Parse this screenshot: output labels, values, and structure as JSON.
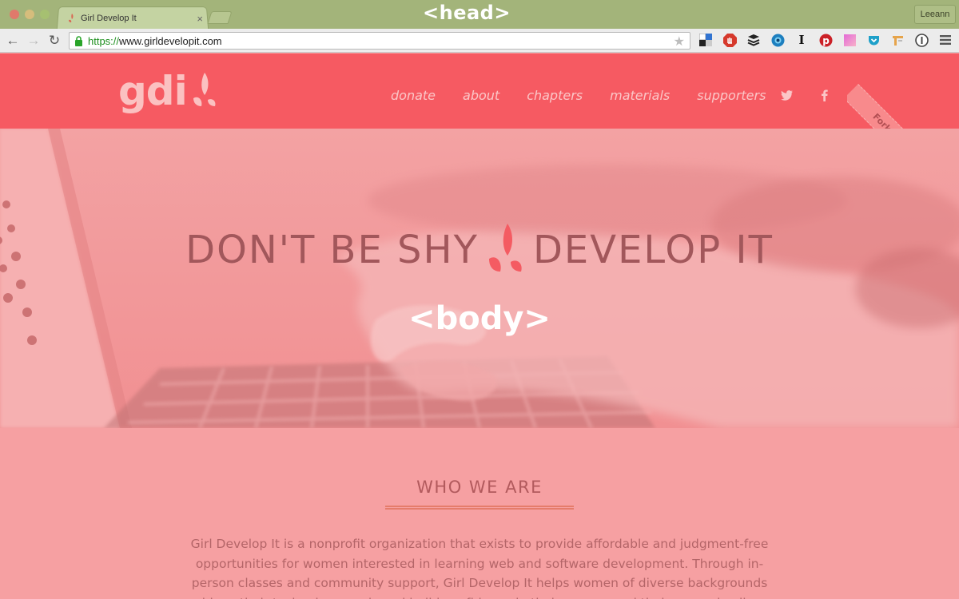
{
  "browser": {
    "tab_title": "Girl Develop It",
    "tab_close": "×",
    "url_scheme": "https://",
    "url_host": "www.girldevelopit.com",
    "user_button": "Leeann",
    "extensions": [
      "delicious-icon",
      "adblock-icon",
      "buffer-icon",
      "chrome-icon",
      "instapaper-icon",
      "pinterest-icon",
      "color-picker-icon",
      "pocket-icon",
      "toolbox-icon",
      "onepassword-icon",
      "menu-icon"
    ]
  },
  "annotations": {
    "head_tag": "<head>",
    "body_tag": "<body>"
  },
  "site": {
    "logo_text": "gdi",
    "nav": [
      "donate",
      "about",
      "chapters",
      "materials",
      "supporters"
    ],
    "ribbon": "Fork me on GitHub",
    "hero_left": "DON'T BE SHY",
    "hero_right": "DEVELOP IT",
    "who_title": "WHO WE ARE",
    "who_text": "Girl Develop It is a nonprofit organization that exists to provide affordable and judgment-free opportunities for women interested in learning web and software development. Through in-person classes and community support, Girl Develop It helps women of diverse backgrounds achieve their technology goals and build confidence in their careers and their every day lives."
  },
  "colors": {
    "header": "#f65a62",
    "hero_overlay": "#f3999a",
    "browser_frame": "#a3b47a"
  }
}
